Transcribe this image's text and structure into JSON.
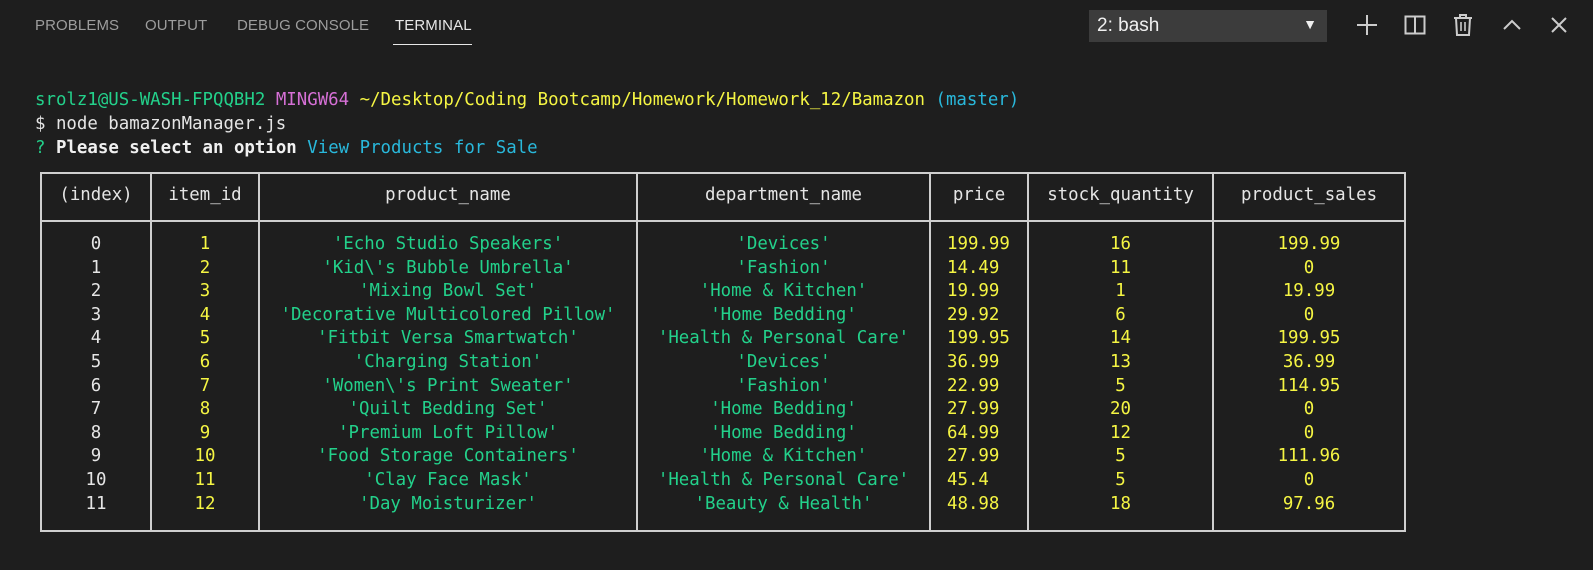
{
  "panel": {
    "tabs": [
      {
        "label": "PROBLEMS"
      },
      {
        "label": "OUTPUT"
      },
      {
        "label": "DEBUG CONSOLE"
      },
      {
        "label": "TERMINAL"
      }
    ],
    "active_tab": "TERMINAL",
    "terminal_select": {
      "value": "2: bash"
    },
    "actions": [
      "plus-icon",
      "split-icon",
      "trash-icon",
      "chevron-up-icon",
      "close-icon"
    ]
  },
  "terminal": {
    "prompt": {
      "user_host": "srolz1@US-WASH-FPQQBH2",
      "shell": "MINGW64",
      "path": "~/Desktop/Coding Bootcamp/Homework/Homework_12/Bamazon",
      "branch": "(master)"
    },
    "command": "$ node bamazonManager.js",
    "question_mark": "?",
    "question": "Please select an option",
    "answer": "View Products for Sale",
    "table": {
      "headers": [
        "(index)",
        "item_id",
        "product_name",
        "department_name",
        "price",
        "stock_quantity",
        "product_sales"
      ],
      "rows": [
        {
          "index": "0",
          "item_id": "1",
          "product_name": "'Echo Studio Speakers'",
          "department_name": "'Devices'",
          "price": "199.99",
          "stock_quantity": "16",
          "product_sales": "199.99"
        },
        {
          "index": "1",
          "item_id": "2",
          "product_name": "'Kid\\'s Bubble Umbrella'",
          "department_name": "'Fashion'",
          "price": "14.49",
          "stock_quantity": "11",
          "product_sales": "0"
        },
        {
          "index": "2",
          "item_id": "3",
          "product_name": "'Mixing Bowl Set'",
          "department_name": "'Home & Kitchen'",
          "price": "19.99",
          "stock_quantity": "1",
          "product_sales": "19.99"
        },
        {
          "index": "3",
          "item_id": "4",
          "product_name": "'Decorative Multicolored Pillow'",
          "department_name": "'Home Bedding'",
          "price": "29.92",
          "stock_quantity": "6",
          "product_sales": "0"
        },
        {
          "index": "4",
          "item_id": "5",
          "product_name": "'Fitbit Versa Smartwatch'",
          "department_name": "'Health & Personal Care'",
          "price": "199.95",
          "stock_quantity": "14",
          "product_sales": "199.95"
        },
        {
          "index": "5",
          "item_id": "6",
          "product_name": "'Charging Station'",
          "department_name": "'Devices'",
          "price": "36.99",
          "stock_quantity": "13",
          "product_sales": "36.99"
        },
        {
          "index": "6",
          "item_id": "7",
          "product_name": "'Women\\'s Print Sweater'",
          "department_name": "'Fashion'",
          "price": "22.99",
          "stock_quantity": "5",
          "product_sales": "114.95"
        },
        {
          "index": "7",
          "item_id": "8",
          "product_name": "'Quilt Bedding Set'",
          "department_name": "'Home Bedding'",
          "price": "27.99",
          "stock_quantity": "20",
          "product_sales": "0"
        },
        {
          "index": "8",
          "item_id": "9",
          "product_name": "'Premium Loft Pillow'",
          "department_name": "'Home Bedding'",
          "price": "64.99",
          "stock_quantity": "12",
          "product_sales": "0"
        },
        {
          "index": "9",
          "item_id": "10",
          "product_name": "'Food Storage Containers'",
          "department_name": "'Home & Kitchen'",
          "price": "27.99",
          "stock_quantity": "5",
          "product_sales": "111.96"
        },
        {
          "index": "10",
          "item_id": "11",
          "product_name": "'Clay Face Mask'",
          "department_name": "'Health & Personal Care'",
          "price": "45.4",
          "stock_quantity": "5",
          "product_sales": "0"
        },
        {
          "index": "11",
          "item_id": "12",
          "product_name": "'Day Moisturizer'",
          "department_name": "'Beauty & Health'",
          "price": "48.98",
          "stock_quantity": "18",
          "product_sales": "97.96"
        }
      ]
    }
  },
  "colors": {
    "background": "#1e1e1e",
    "green": "#23d18b",
    "magenta": "#d670d6",
    "yellow": "#f5f543",
    "cyan": "#29b8db"
  }
}
